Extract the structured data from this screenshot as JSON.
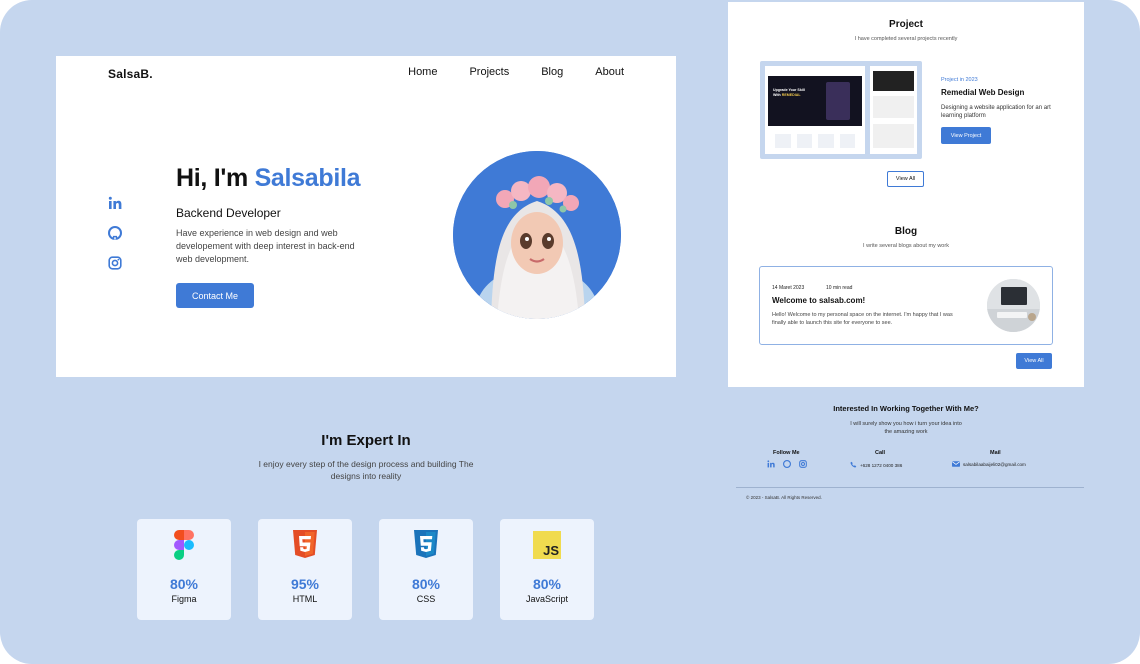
{
  "hero": {
    "logo": "SalsaB.",
    "nav": [
      "Home",
      "Projects",
      "Blog",
      "About"
    ],
    "greeting": "Hi, I'm ",
    "name": "Salsabila",
    "role": "Backend Developer",
    "description": "Have experience in web design and web developement with deep interest in back-end web development.",
    "cta": "Contact Me"
  },
  "expert": {
    "title": "I'm Expert In",
    "subtitle": "I enjoy every step of the design process and building The designs into reality",
    "skills": [
      {
        "name": "Figma",
        "percent": "80%",
        "icon": "figma-icon"
      },
      {
        "name": "HTML",
        "percent": "95%",
        "icon": "html5-icon"
      },
      {
        "name": "CSS",
        "percent": "80%",
        "icon": "css3-icon"
      },
      {
        "name": "JavaScript",
        "percent": "80%",
        "icon": "javascript-icon"
      }
    ]
  },
  "project": {
    "title": "Project",
    "subtitle": "I have completed several projects recently",
    "meta": "Project in 2023",
    "name": "Remedial Web Design",
    "description": "Designing a website application for an art learning platform",
    "view_button": "View Project",
    "view_all": "View All",
    "thumb_heading": "Upgrade Your Skill With REMEDIAL",
    "thumb_heading_1": "Upgrade Your Skill",
    "thumb_heading_2": "With ",
    "thumb_highlight": "REMEDIAL"
  },
  "blog": {
    "title": "Blog",
    "subtitle": "I write several blogs about my work",
    "date": "14 Maret 2023",
    "read_time": "10 min read",
    "post_title": "Welcome to salsab.com!",
    "post_text": "Hello! Welcome to my personal space on the internet. I'm happy that I was finally able to launch this site for everyone to see.",
    "view_all": "View All"
  },
  "footer": {
    "title": "Interested In Working Together With Me?",
    "subtitle": "I will surely show you how i turn your idea into the amazing work",
    "follow_label": "Follow Me",
    "call_label": "Call",
    "call_value": "+628 1272 0400 386",
    "mail_label": "Mail",
    "mail_value": "salsabilaabaijeli02@gmail.com",
    "copyright": "© 2023 - SalsaB. All Rights Reserved."
  },
  "colors": {
    "accent": "#3f7ad6",
    "background": "#c5d6ee",
    "card": "#edf3fd"
  }
}
